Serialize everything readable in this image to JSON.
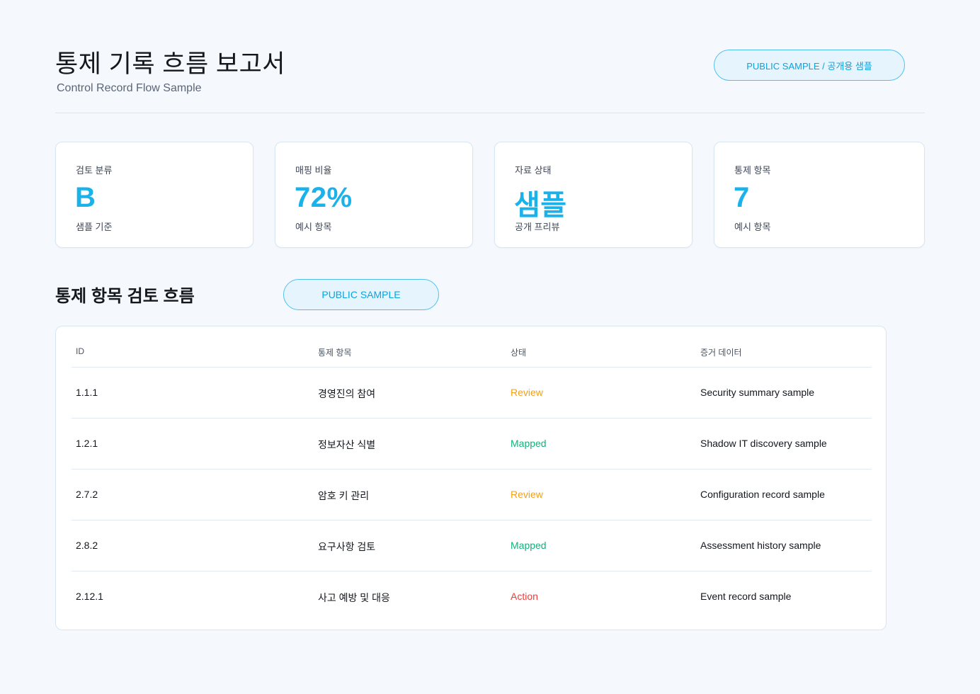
{
  "header": {
    "title": "통제 기록 흐름 보고서",
    "subtitle": "Control Record Flow Sample",
    "badge": "PUBLIC SAMPLE / 공개용 샘플"
  },
  "stats": [
    {
      "label": "검토 분류",
      "value": "B",
      "note": "샘플 기준"
    },
    {
      "label": "매핑 비율",
      "value": "72%",
      "note": "예시 항목"
    },
    {
      "label": "자료 상태",
      "value": "샘플",
      "note": "공개 프리뷰"
    },
    {
      "label": "통제 항목",
      "value": "7",
      "note": "예시 항목"
    }
  ],
  "section": {
    "title": "통제 항목 검토 흐름",
    "badge": "PUBLIC SAMPLE"
  },
  "table": {
    "columns": [
      "ID",
      "통제 항목",
      "상태",
      "증거 데이터"
    ],
    "rows": [
      {
        "id": "1.1.1",
        "item": "경영진의 참여",
        "status": "Review",
        "evidence": "Security summary sample"
      },
      {
        "id": "1.2.1",
        "item": "정보자산 식별",
        "status": "Mapped",
        "evidence": "Shadow IT discovery sample"
      },
      {
        "id": "2.7.2",
        "item": "암호 키 관리",
        "status": "Review",
        "evidence": "Configuration record sample"
      },
      {
        "id": "2.8.2",
        "item": "요구사항 검토",
        "status": "Mapped",
        "evidence": "Assessment history sample"
      },
      {
        "id": "2.12.1",
        "item": "사고 예방 및 대응",
        "status": "Action",
        "evidence": "Event record sample"
      }
    ]
  },
  "colors": {
    "accent": "#1ab2ea",
    "review": "#f0a01a",
    "mapped": "#14b07a",
    "action": "#ef3b3b"
  }
}
